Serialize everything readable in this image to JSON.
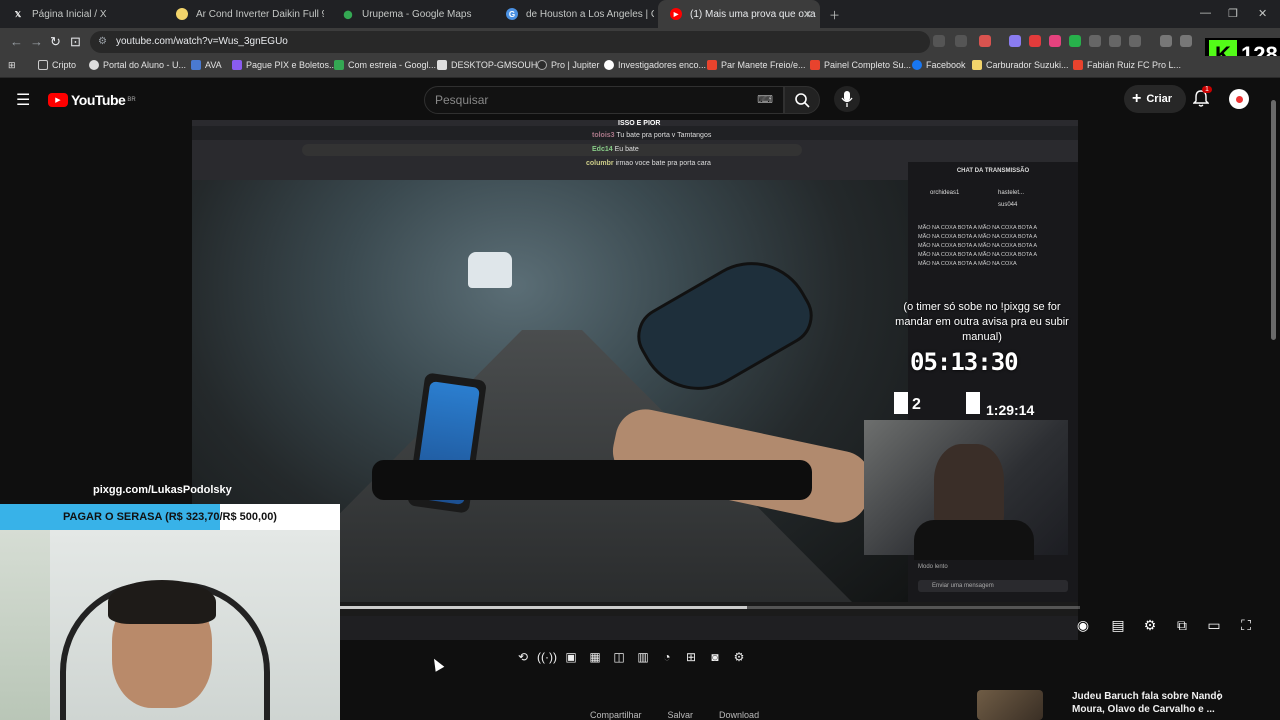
{
  "tabs": [
    {
      "label": "Página Inicial / X",
      "icon": "x-logo-icon"
    },
    {
      "label": "Ar Cond Inverter Daikin Full 9000 Bt",
      "icon": "store-icon"
    },
    {
      "label": "Urupema - Google Maps",
      "icon": "maps-icon"
    },
    {
      "label": "de Houston a Los Angeles | Google",
      "icon": "google-icon"
    },
    {
      "label": "(1) Mais uma prova que o ra",
      "icon": "youtube-icon",
      "active": true
    }
  ],
  "address": {
    "url": "youtube.com/watch?v=Wus_3gnEGUo"
  },
  "bookmarks": [
    {
      "label": "Cripto"
    },
    {
      "label": "Portal do Aluno - U..."
    },
    {
      "label": "AVA"
    },
    {
      "label": "Pague PIX e Boletos..."
    },
    {
      "label": "Com estreia - Googl..."
    },
    {
      "label": "DESKTOP-GMSOUHF"
    },
    {
      "label": "Pro | Jupiter"
    },
    {
      "label": "Investigadores enco..."
    },
    {
      "label": "Par Manete Freio/e..."
    },
    {
      "label": "Painel Completo Su..."
    },
    {
      "label": "Facebook"
    },
    {
      "label": "Carburador Suzuki..."
    },
    {
      "label": "Fabián Ruiz FC Pro L..."
    }
  ],
  "kick_badge": {
    "letter": "K",
    "count": "128"
  },
  "youtube": {
    "logo": "YouTube",
    "region": "BR",
    "search_placeholder": "Pesquisar",
    "create_label": "Criar",
    "notif_count": "1"
  },
  "video_overlay": {
    "chat_lines": [
      {
        "user": "tolois3",
        "text": "Tu bate pra porta v Tamtangos"
      },
      {
        "user": "Edc14",
        "text": "Eu bate"
      },
      {
        "user": "columbr",
        "text": "irmao voce bate pra porta cara"
      }
    ],
    "header_top": "ISSO E PIOR",
    "stream_chat_title": "CHAT DA TRANSMISSÃO",
    "spam_line": "MÃO NA COXA BOTA A MÃO NA COXA BOTA A",
    "spam_last": "MÃO NA COXA BOTA A MÃO NA COXA",
    "timer_note": "(o timer só sobe no !pixgg se for mandar em outra avisa pra eu subir manual)",
    "timer": "05:13:30",
    "counter": "2",
    "sub_timer": "1:29:14",
    "chat_input_placeholder": "Enviar uma mensagem",
    "chat_mode": "Modo lento",
    "users": [
      {
        "name": "orchideas1"
      },
      {
        "name": "hastelet..."
      },
      {
        "name": "sus044"
      }
    ]
  },
  "sponsor": {
    "url": "pixgg.com/LukasPodolsky"
  },
  "goal": {
    "label": "PAGAR O SERASA (R$ 323,70/R$ 500,00)",
    "current": 323.7,
    "target": 500.0
  },
  "progress": {
    "played_fraction": 0.55
  },
  "suggestion": {
    "title": "Judeu Baruch fala sobre Nando Moura, Olavo de Carvalho e ..."
  },
  "actions": [
    {
      "label": "Compartilhar"
    },
    {
      "label": "Salvar"
    },
    {
      "label": "Download"
    }
  ],
  "colors": {
    "accent": "#ff0000",
    "kick": "#53fc18",
    "goal_fill": "#38b2e8"
  }
}
